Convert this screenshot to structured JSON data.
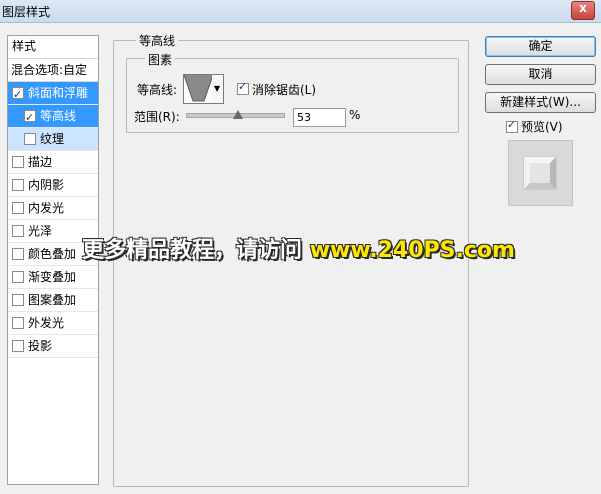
{
  "window": {
    "title": "图层样式",
    "close_label": "x"
  },
  "styles_panel": {
    "header": "样式",
    "blending_options": "混合选项:自定",
    "items": [
      {
        "label": "斜面和浮雕",
        "checked": true
      },
      {
        "label": "等高线",
        "checked": true
      },
      {
        "label": "纹理",
        "checked": false
      },
      {
        "label": "描边",
        "checked": false
      },
      {
        "label": "内阴影",
        "checked": false
      },
      {
        "label": "内发光",
        "checked": false
      },
      {
        "label": "光泽",
        "checked": false
      },
      {
        "label": "颜色叠加",
        "checked": false
      },
      {
        "label": "渐变叠加",
        "checked": false
      },
      {
        "label": "图案叠加",
        "checked": false
      },
      {
        "label": "外发光",
        "checked": false
      },
      {
        "label": "投影",
        "checked": false
      }
    ]
  },
  "contour_panel": {
    "group_title": "等高线",
    "subgroup_title": "图素",
    "contour_label": "等高线:",
    "antialias_label": "消除锯齿(L)",
    "antialias_checked": true,
    "range_label": "范围(R):",
    "range_value": "53",
    "range_unit": "%"
  },
  "buttons": {
    "ok": "确定",
    "cancel": "取消",
    "new_style": "新建样式(W)...",
    "preview_label": "预览(V)",
    "preview_checked": true
  },
  "watermark": {
    "text": "更多精品教程，请访问",
    "url": "www.240PS.com"
  }
}
